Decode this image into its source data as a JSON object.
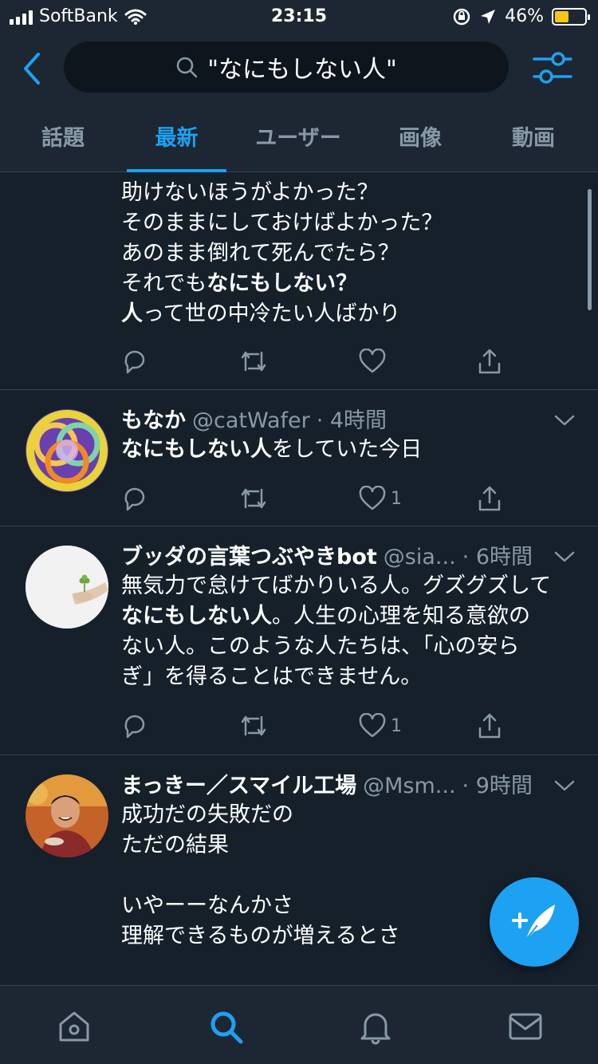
{
  "status_bar": {
    "carrier": "SoftBank",
    "time": "23:15",
    "battery_percent": "46%",
    "battery_level": 0.46
  },
  "header": {
    "search_query": "\"なにもしない人\"",
    "tabs": [
      {
        "label": "話題",
        "active": false
      },
      {
        "label": "最新",
        "active": true
      },
      {
        "label": "ユーザー",
        "active": false
      },
      {
        "label": "画像",
        "active": false
      },
      {
        "label": "動画",
        "active": false
      }
    ]
  },
  "tweets": [
    {
      "lines": [
        {
          "text": "助けないほうがよかった？"
        },
        {
          "text": "そのままにしておけばよかった？"
        },
        {
          "text": "あのまま倒れて死んでたら？"
        },
        {
          "pre": "それでも",
          "bold": "なにもしない？"
        },
        {
          "bold": "人",
          "post": "って世の中冷たい人ばかり"
        }
      ],
      "likes": ""
    },
    {
      "name": "もなか",
      "handle": "@catWafer",
      "time": "· 4時間",
      "lines": [
        {
          "bold": "なにもしない人",
          "post": "をしていた今日"
        }
      ],
      "likes": "1"
    },
    {
      "name": "ブッダの言葉つぶやきbot",
      "handle": "@sia...",
      "time": "· 6時間",
      "lines": [
        {
          "text": "無気力で怠けてばかりいる人。グズグズして"
        },
        {
          "bold": "なにもしない人",
          "post": "。人生の心理を知る意欲の"
        },
        {
          "text": "ない人。このような人たちは、「心の安ら"
        },
        {
          "text": "ぎ」を得ることはできません。"
        }
      ],
      "likes": "1"
    },
    {
      "name": "まっきー／スマイル工場",
      "handle": "@Msm...",
      "time": "· 9時間",
      "lines": [
        {
          "text": "成功だの失敗だの"
        },
        {
          "text": "ただの結果"
        },
        {
          "text": ""
        },
        {
          "text": "いやーーなんかさ"
        },
        {
          "text": "理解できるものが増えるとさ"
        }
      ]
    }
  ],
  "icons": {
    "back": "chevron-left-icon",
    "search": "search-icon",
    "filter": "sliders-icon",
    "reply": "reply-icon",
    "retweet": "retweet-icon",
    "like": "heart-icon",
    "share": "share-icon",
    "compose": "compose-feather-icon",
    "nav": [
      "home-icon",
      "search-icon",
      "bell-icon",
      "mail-icon"
    ]
  },
  "colors": {
    "background": "#15202b",
    "header": "#1c2733",
    "accent": "#1da1f2",
    "muted": "#8899a6",
    "divider": "#38444d",
    "battery": "#f5c518"
  }
}
